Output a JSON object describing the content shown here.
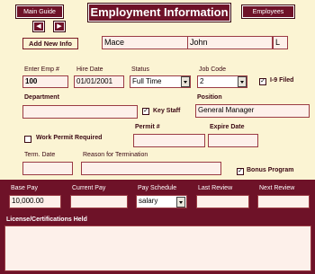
{
  "header": {
    "main_guide": "Main Guide",
    "title": "Employment Information",
    "employees": "Employees",
    "prev_arrow": "◀",
    "next_arrow": "▶"
  },
  "employee": {
    "add_new": "Add New Info",
    "last_name": "Mace",
    "first_name": "John",
    "middle_initial": "L"
  },
  "row1": {
    "enter_emp_label": "Enter Emp #",
    "enter_emp_value": "100",
    "hire_date_label": "Hire Date",
    "hire_date_value": "01/01/2001",
    "status_label": "Status",
    "status_value": "Full Time",
    "job_code_label": "Job Code",
    "job_code_value": "2",
    "i9_label": "I-9 Filed",
    "i9_checked": "✓"
  },
  "row2": {
    "department_label": "Department",
    "department_value": "",
    "key_staff_label": "Key Staff",
    "key_staff_checked": "✓",
    "position_label": "Position",
    "position_value": "General Manager"
  },
  "row3": {
    "work_permit_label": "Work Permit Required",
    "permit_label": "Permit #",
    "permit_value": "",
    "expire_label": "Expire Date",
    "expire_value": ""
  },
  "row4": {
    "term_date_label": "Term. Date",
    "term_date_value": "",
    "reason_label": "Reason for Termination",
    "reason_value": "",
    "bonus_label": "Bonus Program",
    "bonus_checked": "✓"
  },
  "pay": {
    "base_pay_label": "Base Pay",
    "base_pay_value": "10,000.00",
    "current_pay_label": "Current Pay",
    "current_pay_value": "",
    "pay_schedule_label": "Pay Schedule",
    "pay_schedule_value": "salary",
    "last_review_label": "Last Review",
    "last_review_value": "",
    "next_review_label": "Next Review",
    "next_review_value": ""
  },
  "license": {
    "label": "License/Certifications Held",
    "value": ""
  },
  "colors": {
    "background": "#fbf4d3",
    "accent": "#6e1228",
    "field_border": "#9a3b44"
  }
}
